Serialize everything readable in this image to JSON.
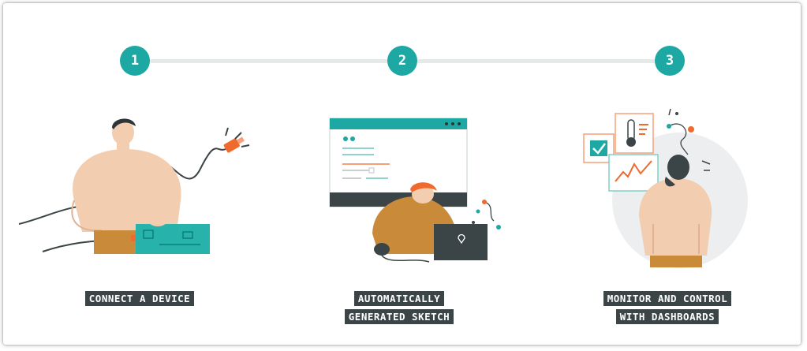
{
  "steps": [
    {
      "number": "1",
      "caption_lines": [
        "CONNECT A DEVICE"
      ],
      "illustration": "person-connecting-cable-to-board"
    },
    {
      "number": "2",
      "caption_lines": [
        "AUTOMATICALLY",
        "GENERATED SKETCH"
      ],
      "illustration": "person-at-laptop-with-code-window"
    },
    {
      "number": "3",
      "caption_lines": [
        "MONITOR AND CONTROL",
        "WITH DASHBOARDS"
      ],
      "illustration": "person-viewing-dashboard-widgets"
    }
  ],
  "colors": {
    "accent_teal": "#1da8a3",
    "connector_line": "#e6e9ea",
    "caption_bg": "#3b4447",
    "caption_text": "#ffffff",
    "skin_peach": "#f2cdb0",
    "mustard": "#c98a3a",
    "orange": "#ef6a2c",
    "dark": "#3b4447"
  }
}
